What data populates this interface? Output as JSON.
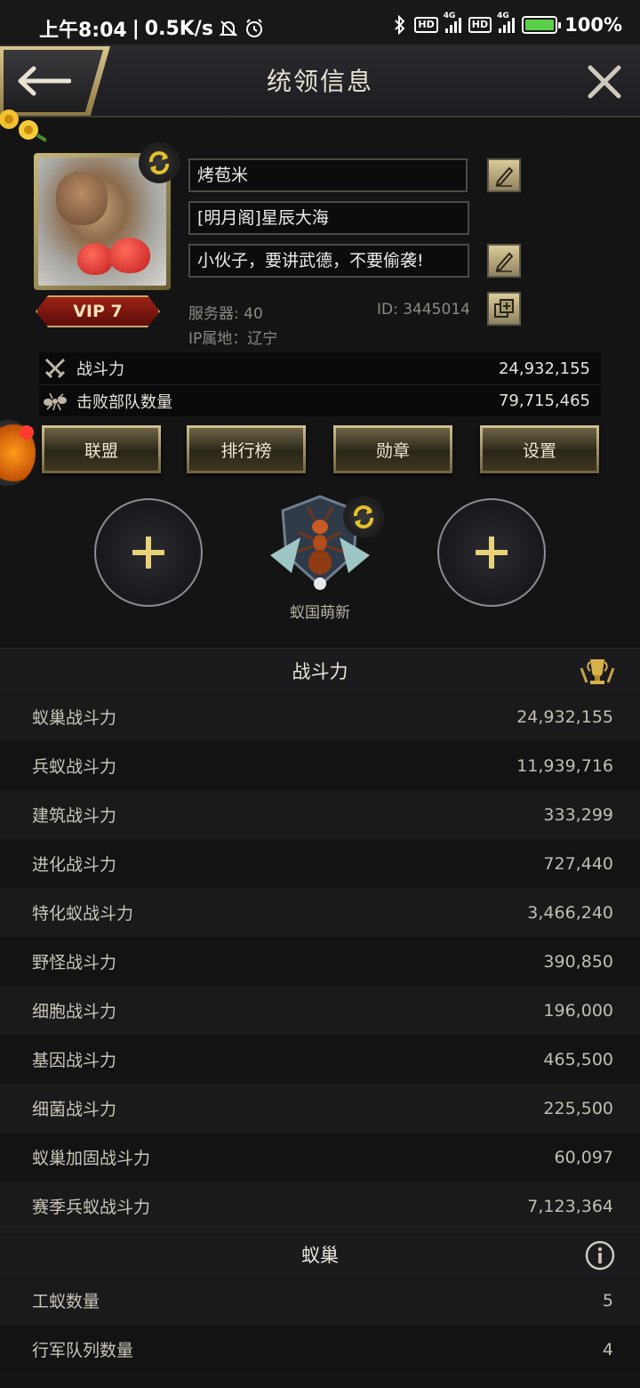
{
  "status_bar": {
    "time": "上午8:04",
    "net_speed": "0.5K/s",
    "hd1": "HD",
    "net1": "4G",
    "hd2": "HD",
    "net2": "4G",
    "battery": "100%"
  },
  "header": {
    "title": "统领信息"
  },
  "profile": {
    "name": "烤苞米",
    "alliance_line": "[明月阁]星辰大海",
    "signature": "小伙子，要讲武德，不要偷袭!",
    "vip": "VIP 7",
    "server": "服务器: 40",
    "player_id": "ID: 3445014",
    "ip_location": "IP属地：辽宁"
  },
  "summary": [
    {
      "label": "战斗力",
      "value": "24,932,155",
      "icon": "crossed-swords-icon"
    },
    {
      "label": "击败部队数量",
      "value": "79,715,465",
      "icon": "ant-icon"
    }
  ],
  "actions": [
    "联盟",
    "排行榜",
    "勋章",
    "设置"
  ],
  "emblem": {
    "label": "蚁国萌新"
  },
  "power_section": {
    "title": "战斗力",
    "rows": [
      {
        "label": "蚁巢战斗力",
        "value": "24,932,155"
      },
      {
        "label": "兵蚁战斗力",
        "value": "11,939,716"
      },
      {
        "label": "建筑战斗力",
        "value": "333,299"
      },
      {
        "label": "进化战斗力",
        "value": "727,440"
      },
      {
        "label": "特化蚁战斗力",
        "value": "3,466,240"
      },
      {
        "label": "野怪战斗力",
        "value": "390,850"
      },
      {
        "label": "细胞战斗力",
        "value": "196,000"
      },
      {
        "label": "基因战斗力",
        "value": "465,500"
      },
      {
        "label": "细菌战斗力",
        "value": "225,500"
      },
      {
        "label": "蚁巢加固战斗力",
        "value": "60,097"
      },
      {
        "label": "赛季兵蚁战斗力",
        "value": "7,123,364"
      }
    ]
  },
  "nest_section": {
    "title": "蚁巢",
    "rows": [
      {
        "label": "工蚁数量",
        "value": "5"
      },
      {
        "label": "行军队列数量",
        "value": "4"
      }
    ]
  },
  "colors": {
    "gold": "#cfc08e",
    "background": "#141414",
    "vip_red": "#9c2318"
  }
}
